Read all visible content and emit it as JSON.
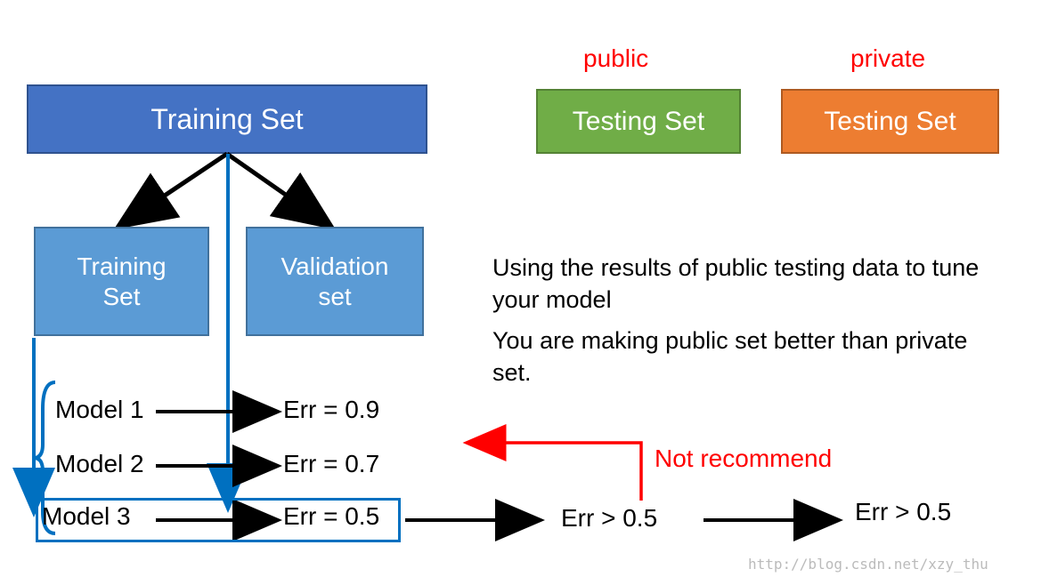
{
  "topBoxes": {
    "trainingSet": "Training Set",
    "publicLabel": "public",
    "privateLabel": "private",
    "testingSetGreen": "Testing Set",
    "testingSetOrange": "Testing Set"
  },
  "subBoxes": {
    "trainingSet": "Training\nSet",
    "validationSet": "Validation\nset"
  },
  "models": {
    "m1": {
      "name": "Model 1",
      "err": "Err = 0.9"
    },
    "m2": {
      "name": "Model 2",
      "err": "Err = 0.7"
    },
    "m3": {
      "name": "Model 3",
      "err": "Err = 0.5"
    }
  },
  "extraErr": {
    "public": "Err > 0.5",
    "private": "Err > 0.5"
  },
  "sideText": {
    "line1": "Using the results of public testing data to tune your model",
    "line2": "You are making public set better than private set."
  },
  "notRecommend": "Not recommend",
  "watermark": "http://blog.csdn.net/xzy_thu"
}
